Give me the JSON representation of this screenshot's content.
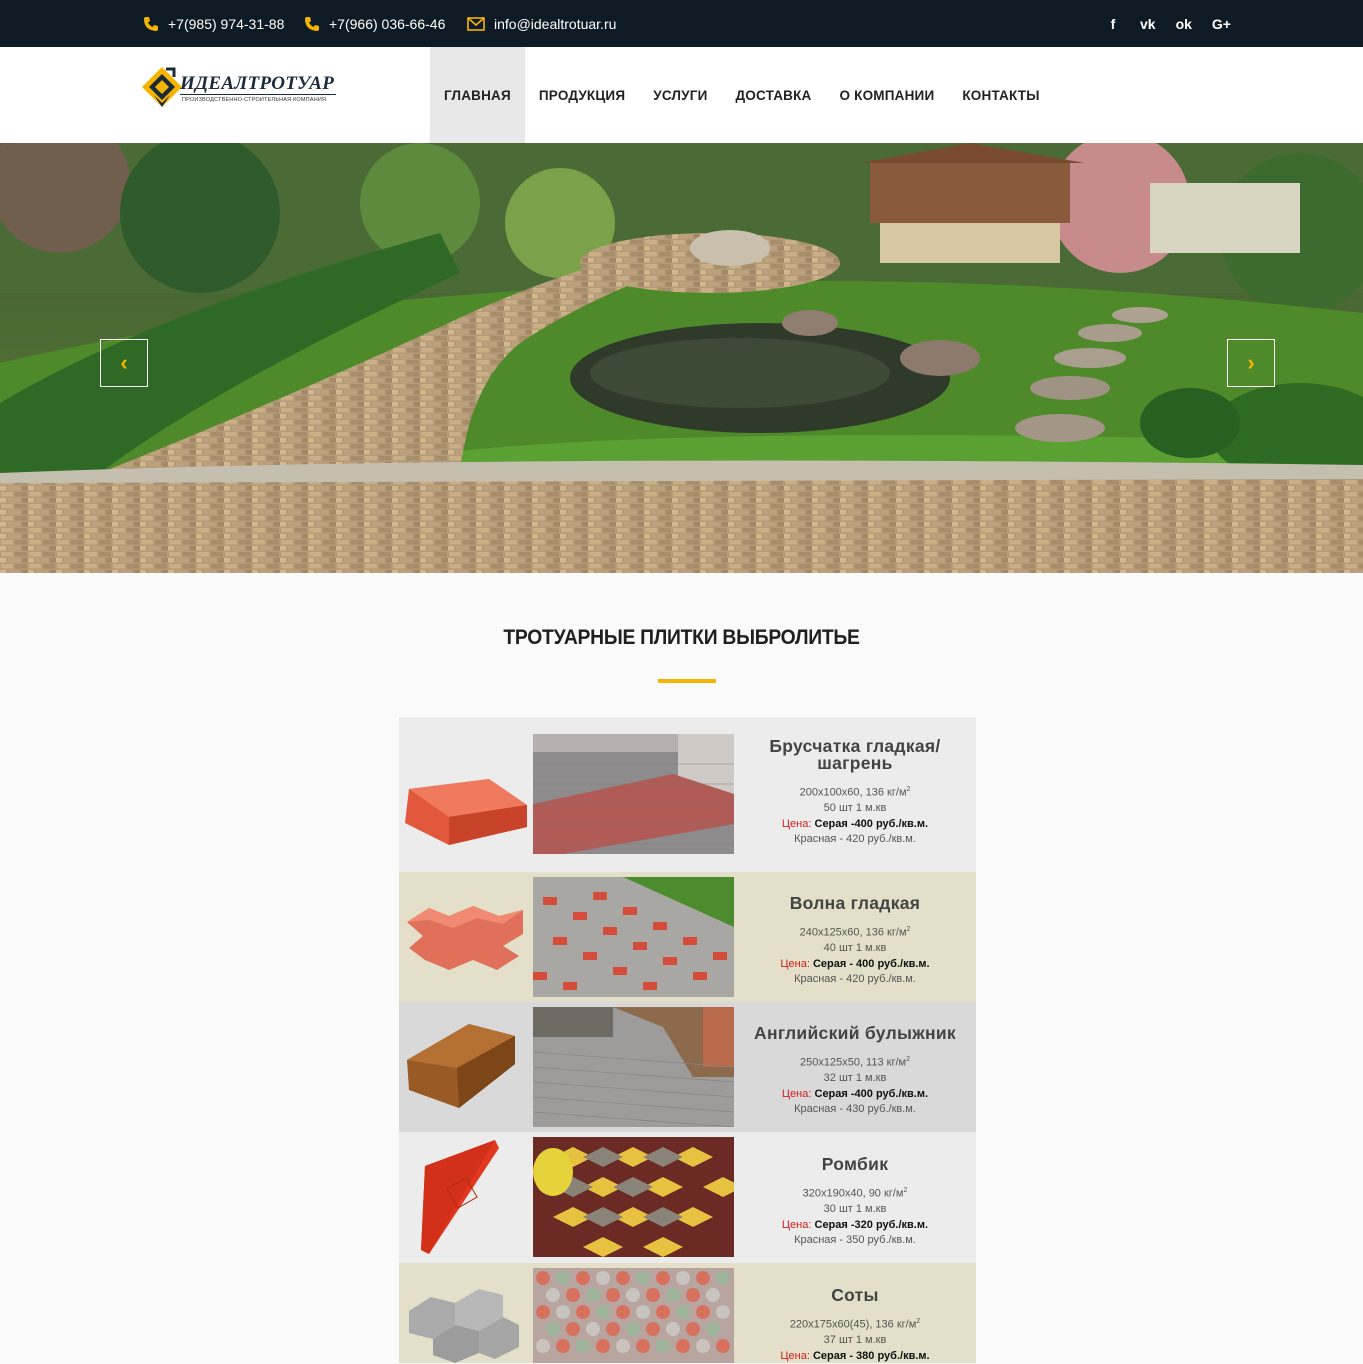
{
  "topbar": {
    "phone1": "+7(985) 974-31-88",
    "phone2": "+7(966) 036-66-46",
    "email": "info@idealtrotuar.ru",
    "socials": [
      {
        "icon": "facebook-icon",
        "glyph": "f"
      },
      {
        "icon": "vk-icon",
        "glyph": "vk"
      },
      {
        "icon": "odnoklassniki-icon",
        "glyph": "ok"
      },
      {
        "icon": "google-plus-icon",
        "glyph": "G+"
      }
    ],
    "accent": "#f5b400"
  },
  "logo": {
    "title": "ИДЕАЛТРОТУАР",
    "subtitle": "производственно-строительная компания"
  },
  "nav": {
    "items": [
      "ГЛАВНАЯ",
      "ПРОДУКЦИЯ",
      "УСЛУГИ",
      "ДОСТАВКА",
      "О КОМПАНИИ",
      "КОНТАКТЫ"
    ],
    "active": "ГЛАВНАЯ"
  },
  "hero": {
    "prev_glyph": "‹",
    "next_glyph": "›"
  },
  "section": {
    "title": "ТРОТУАРНЫЕ ПЛИТКИ ВЫБРОЛИТЬЕ"
  },
  "products": [
    {
      "name": "Брусчатка гладкая/ шагрень",
      "size": "200x100x60, 136 кг/м",
      "pcs": "50 шт 1 м.кв",
      "price_label": "Цена:",
      "price_grey": "Серая -400 руб./кв.м.",
      "price_red": "Красная - 420 руб./кв.м.",
      "bg": "#ececec"
    },
    {
      "name": "Волна гладкая",
      "size": "240x125x60, 136 кг/м",
      "pcs": "40 шт 1 м.кв",
      "price_label": "Цена:",
      "price_grey": "Серая - 400 руб./кв.м.",
      "price_red": "Красная - 420 руб./кв.м.",
      "bg": "#e3dfc8"
    },
    {
      "name": "Английский булыжник",
      "size": "250x125x50, 113 кг/м",
      "pcs": "32 шт 1 м.кв",
      "price_label": "Цена:",
      "price_grey": "Серая -400 руб./кв.м.",
      "price_red": "Красная - 430 руб./кв.м.",
      "bg": "#d9d9d9"
    },
    {
      "name": "Ромбик",
      "size": "320x190x40, 90 кг/м",
      "pcs": "30 шт 1 м.кв",
      "price_label": "Цена:",
      "price_grey": "Серая -320 руб./кв.м.",
      "price_red": "Красная - 350 руб./кв.м.",
      "bg": "#ececec"
    },
    {
      "name": "Соты",
      "size": "220x175x60(45), 136 кг/м",
      "pcs": "37 шт 1 м.кв",
      "price_label": "Цена:",
      "price_grey": "Серая - 380 руб./кв.м.",
      "price_red": "",
      "bg": "#e3dfc8"
    }
  ]
}
